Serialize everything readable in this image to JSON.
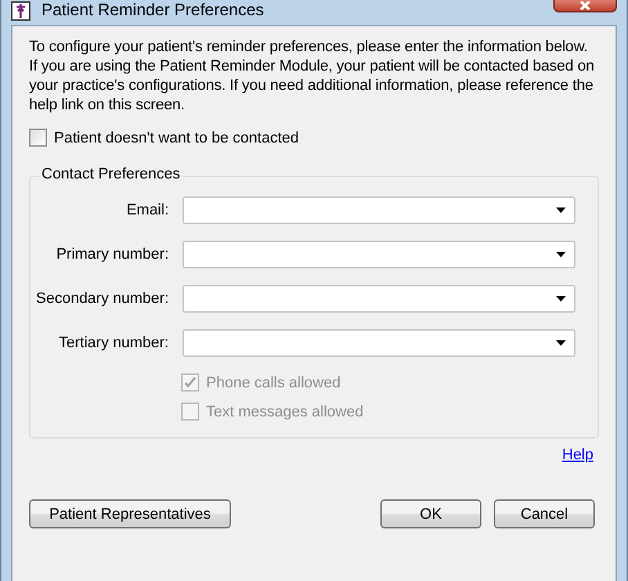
{
  "window": {
    "title": "Patient Reminder Preferences"
  },
  "intro": "To configure your patient's reminder preferences, please enter the information below. If you are using the Patient Reminder Module, your patient will be contacted based on your practice's configurations. If you need additional information, please reference the help link on this screen.",
  "do_not_contact": {
    "label": "Patient doesn't want to be contacted",
    "checked": false
  },
  "contact_preferences": {
    "title": "Contact Preferences",
    "fields": [
      {
        "label": "Email:"
      },
      {
        "label": "Primary number:"
      },
      {
        "label": "Secondary number:"
      },
      {
        "label": "Tertiary number:"
      }
    ],
    "options": [
      {
        "label": "Phone calls allowed",
        "checked": true,
        "disabled": true
      },
      {
        "label": "Text messages allowed",
        "checked": false,
        "disabled": true
      }
    ]
  },
  "help_link": "Help",
  "buttons": {
    "left": "Patient Representatives",
    "ok": "OK",
    "cancel": "Cancel"
  }
}
